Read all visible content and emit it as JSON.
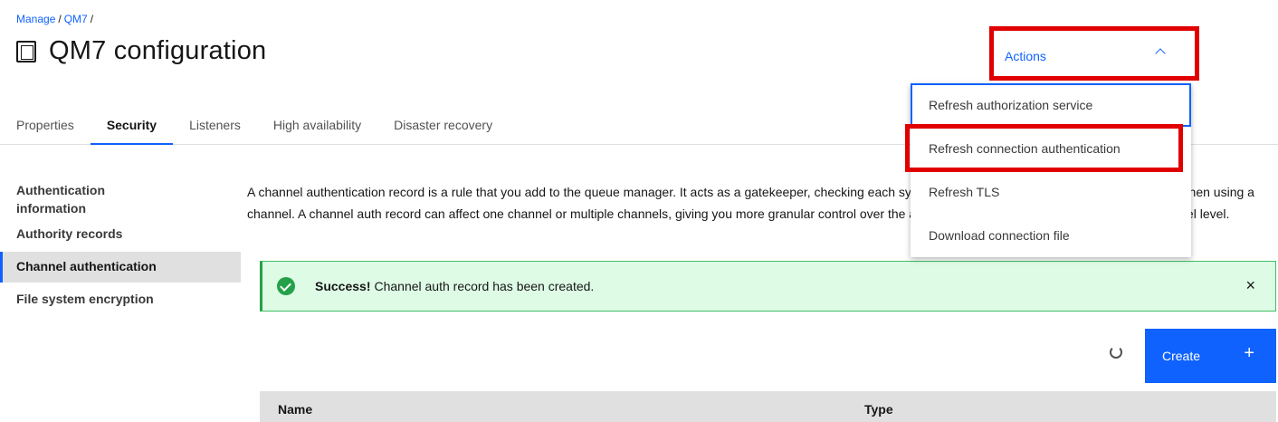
{
  "breadcrumb": {
    "item1": "Manage",
    "sep1": "/",
    "item2": "QM7",
    "sep2": "/"
  },
  "page": {
    "title": "QM7 configuration",
    "title_icon": "document-icon"
  },
  "tabs": [
    {
      "label": "Properties",
      "active": false
    },
    {
      "label": "Security",
      "active": true
    },
    {
      "label": "Listeners",
      "active": false
    },
    {
      "label": "High availability",
      "active": false
    },
    {
      "label": "Disaster recovery",
      "active": false
    }
  ],
  "side_nav": [
    {
      "label": "Authentication information",
      "active": false
    },
    {
      "label": "Authority records",
      "active": false
    },
    {
      "label": "Channel authentication",
      "active": true
    },
    {
      "label": "File system encryption",
      "active": false
    }
  ],
  "description": "A channel authentication record is a rule that you add to the queue manager. It acts as a gatekeeper, checking each system that tries to log in into the queue manager when using a channel. A channel auth record can affect one channel or multiple channels, giving you more granular control over the access granted to connecting systems at a channel level.",
  "notification": {
    "bold": "Success!",
    "text": "Channel auth record has been created.",
    "close": "×"
  },
  "toolbar": {
    "create_label": "Create",
    "create_icon": "+"
  },
  "table": {
    "columns": [
      "Name",
      "Type"
    ]
  },
  "actions": {
    "label": "Actions"
  },
  "actions_menu": [
    {
      "label": "Refresh authorization service"
    },
    {
      "label": "Refresh connection authentication"
    },
    {
      "label": "Refresh TLS"
    },
    {
      "label": "Download connection file"
    }
  ],
  "colors": {
    "primary": "#0f62fe",
    "success": "#24a148",
    "success_bg": "#defbe6",
    "highlight": "#e00000"
  }
}
